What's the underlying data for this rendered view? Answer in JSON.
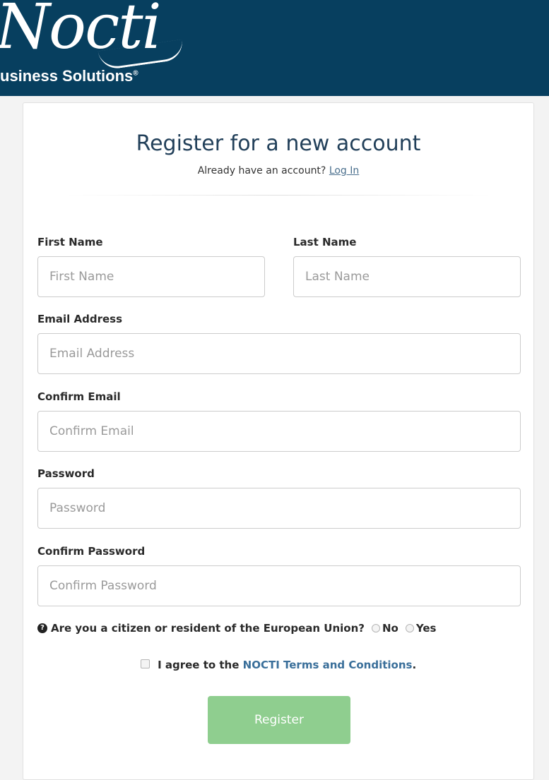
{
  "header": {
    "logo_script": "Nocti",
    "logo_sub": "usiness Solutions",
    "logo_reg": "®"
  },
  "form": {
    "title": "Register for a new account",
    "subtitle_prefix": "Already have an account?",
    "login_link": "Log In",
    "fields": {
      "first_name": {
        "label": "First Name",
        "placeholder": "First Name",
        "value": ""
      },
      "last_name": {
        "label": "Last Name",
        "placeholder": "Last Name",
        "value": ""
      },
      "email": {
        "label": "Email Address",
        "placeholder": "Email Address",
        "value": ""
      },
      "confirm_email": {
        "label": "Confirm Email",
        "placeholder": "Confirm Email",
        "value": ""
      },
      "password": {
        "label": "Password",
        "placeholder": "Password",
        "value": ""
      },
      "confirm_password": {
        "label": "Confirm Password",
        "placeholder": "Confirm Password",
        "value": ""
      }
    },
    "eu_question": "Are you a citizen or resident of the European Union?",
    "eu_options": [
      "No",
      "Yes"
    ],
    "agree_prefix": "I agree to the",
    "terms_link": "NOCTI Terms and Conditions",
    "agree_suffix": ".",
    "register_label": "Register"
  },
  "icons": {
    "question": "question-circle-icon"
  },
  "colors": {
    "header_bg": "#073f5f",
    "title": "#22405a",
    "link": "#3a6f9a",
    "register_button": "#8fce8f"
  }
}
